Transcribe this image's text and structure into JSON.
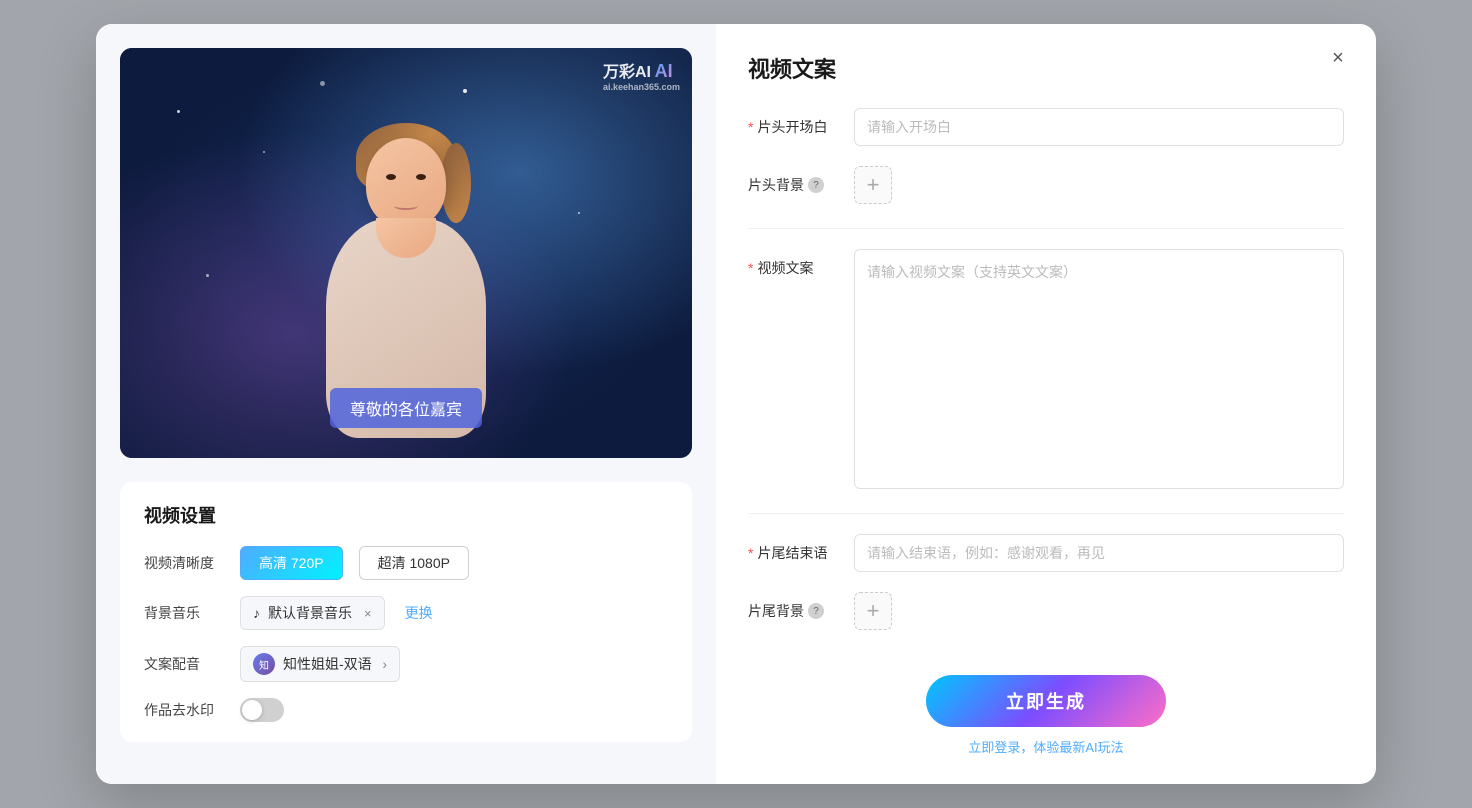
{
  "modal": {
    "close_label": "×",
    "left": {
      "watermark_brand": "万彩AI",
      "watermark_url": "ai.keehan365.com",
      "subtitle_text": "尊敬的各位嘉宾",
      "settings_title": "视频设置",
      "video_quality_label": "视频清晰度",
      "quality_options": [
        {
          "label": "高清 720P",
          "active": true
        },
        {
          "label": "超清 1080P",
          "active": false
        }
      ],
      "music_label": "背景音乐",
      "music_name": "默认背景音乐",
      "music_change": "更换",
      "voice_label": "文案配音",
      "voice_name": "知性姐姐-双语",
      "watermark_label": "作品去水印"
    },
    "right": {
      "title": "视频文案",
      "opening_label": "片头开场白",
      "opening_placeholder": "请输入开场白",
      "opening_required": true,
      "header_bg_label": "片头背景",
      "header_bg_has_help": true,
      "copy_label": "视频文案",
      "copy_placeholder": "请输入视频文案（支持英文文案）",
      "copy_required": true,
      "closing_label": "片尾结束语",
      "closing_placeholder": "请输入结束语，例如：感谢观看，再见",
      "closing_required": true,
      "footer_bg_label": "片尾背景",
      "footer_bg_has_help": true,
      "submit_label": "立即生成",
      "submit_hint_prefix": "立即登录，体验最新AI玩法"
    }
  }
}
